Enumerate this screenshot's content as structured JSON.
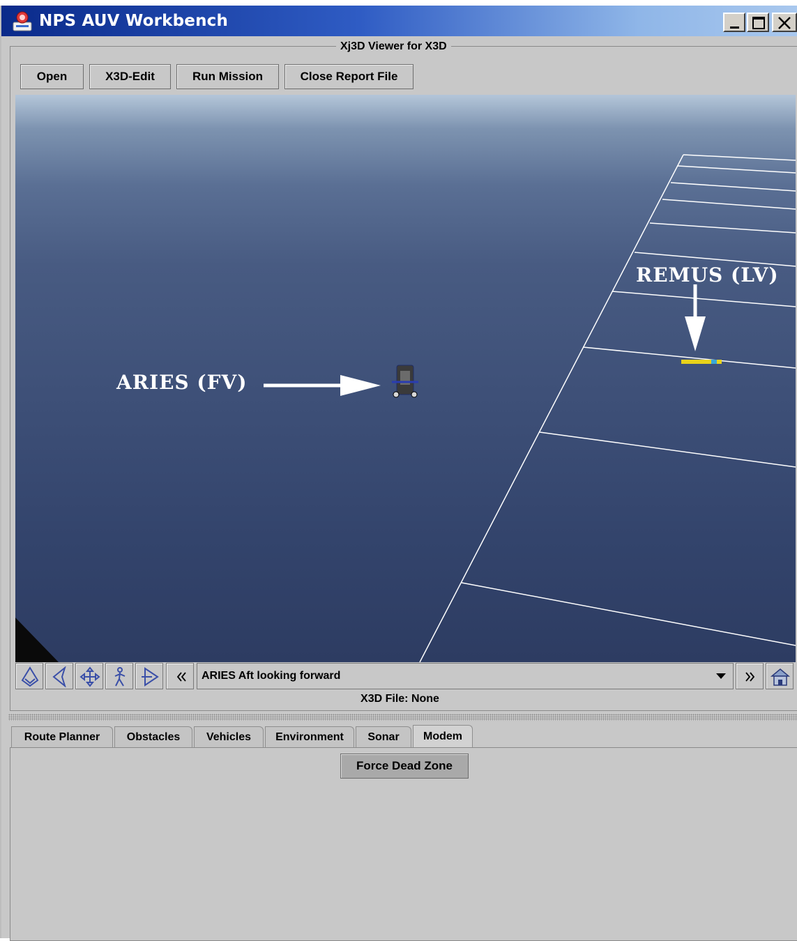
{
  "window": {
    "title": "NPS AUV Workbench",
    "controls": [
      "minimize-icon",
      "maximize-icon",
      "close-icon"
    ]
  },
  "viewer": {
    "group_title": "Xj3D Viewer for X3D",
    "toolbar": [
      "Open",
      "X3D-Edit",
      "Run Mission",
      "Close Report File"
    ],
    "labels": {
      "follower": "ARIES (FV)",
      "leader": "REMUS (LV)"
    },
    "nav_icons": [
      "examine-icon",
      "fly-icon",
      "pan-icon",
      "walk-icon",
      "tilt-icon",
      "previous-viewpoint-icon"
    ],
    "viewpoint": "ARIES Aft looking forward",
    "next_icon": "next-viewpoint-icon",
    "home_icon": "home-icon",
    "file_status": "X3D File: None"
  },
  "tabs": {
    "items": [
      "Route Planner",
      "Obstacles",
      "Vehicles",
      "Environment",
      "Sonar",
      "Modem"
    ],
    "active": "Modem"
  },
  "modem_panel": {
    "button": "Force Dead Zone"
  }
}
